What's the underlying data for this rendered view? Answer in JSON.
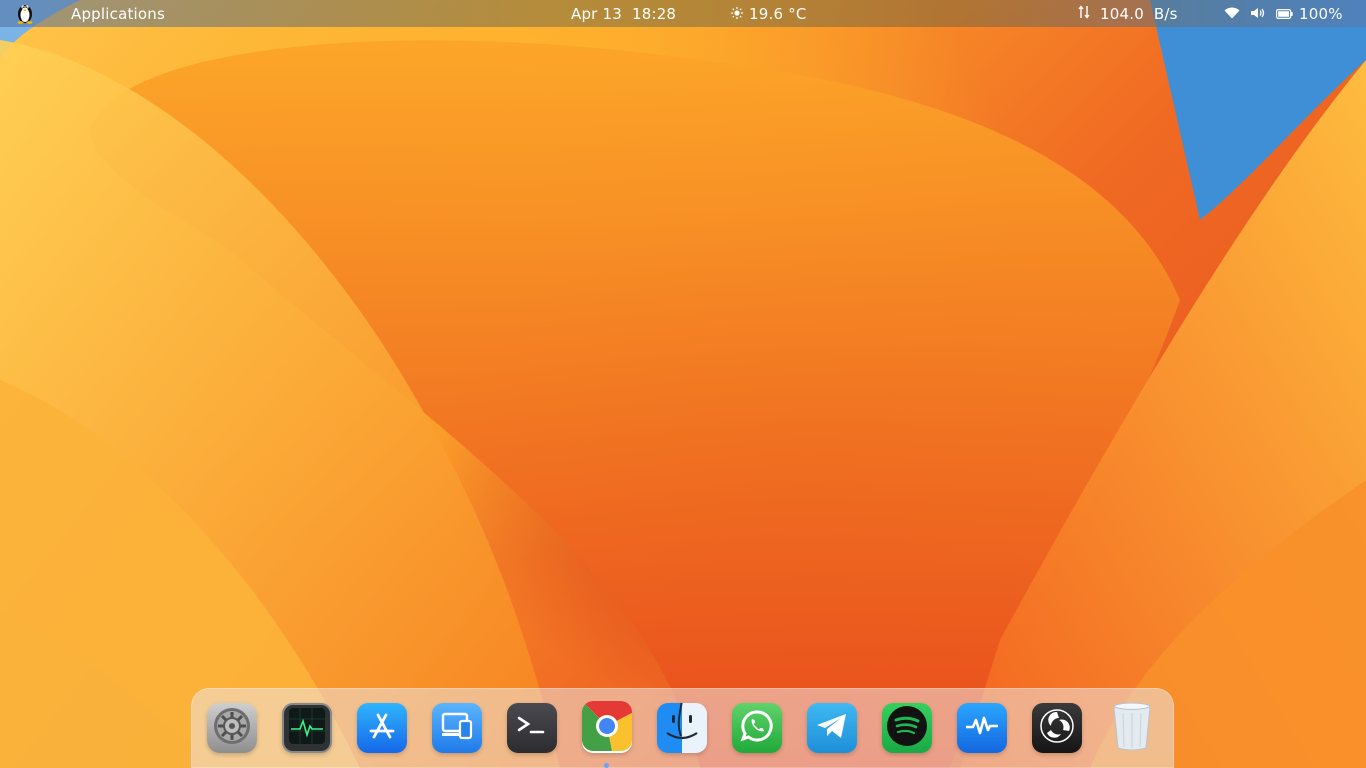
{
  "topbar": {
    "applications_label": "Applications",
    "date": "Apr 13",
    "time": "18:28",
    "temperature": "19.6 °C",
    "network_speed": "104.0  B/s",
    "battery_percent": "100%"
  },
  "icons": {
    "distro": "tux-icon",
    "weather": "sun-icon",
    "network": "up-down-arrows-icon",
    "wifi": "wifi-icon",
    "volume": "speaker-icon",
    "battery": "battery-icon"
  },
  "dock": {
    "items": [
      {
        "name": "settings",
        "icon": "gear-icon",
        "color": "#9a9a9a"
      },
      {
        "name": "activity-monitor",
        "icon": "monitor-icon",
        "color": "#1f2a2a"
      },
      {
        "name": "app-store",
        "icon": "app-store-icon",
        "color": "#1e8ef5"
      },
      {
        "name": "devices",
        "icon": "devices-icon",
        "color": "#2e8ff0"
      },
      {
        "name": "terminal",
        "icon": "terminal-icon",
        "color": "#3a3a3f"
      },
      {
        "name": "chrome",
        "icon": "chrome-icon",
        "color": "#4285f4"
      },
      {
        "name": "finder",
        "icon": "finder-icon",
        "color": "#2e95ee"
      },
      {
        "name": "whatsapp",
        "icon": "whatsapp-icon",
        "color": "#2bb741"
      },
      {
        "name": "telegram",
        "icon": "telegram-icon",
        "color": "#2aa3e6"
      },
      {
        "name": "spotify",
        "icon": "spotify-icon",
        "color": "#1db954"
      },
      {
        "name": "system-monitor",
        "icon": "pulse-icon",
        "color": "#1a8cf0"
      },
      {
        "name": "obs-studio",
        "icon": "obs-icon",
        "color": "#222"
      },
      {
        "name": "trash",
        "icon": "trash-icon",
        "color": "#e8eef2"
      }
    ],
    "running_app": "chrome"
  }
}
